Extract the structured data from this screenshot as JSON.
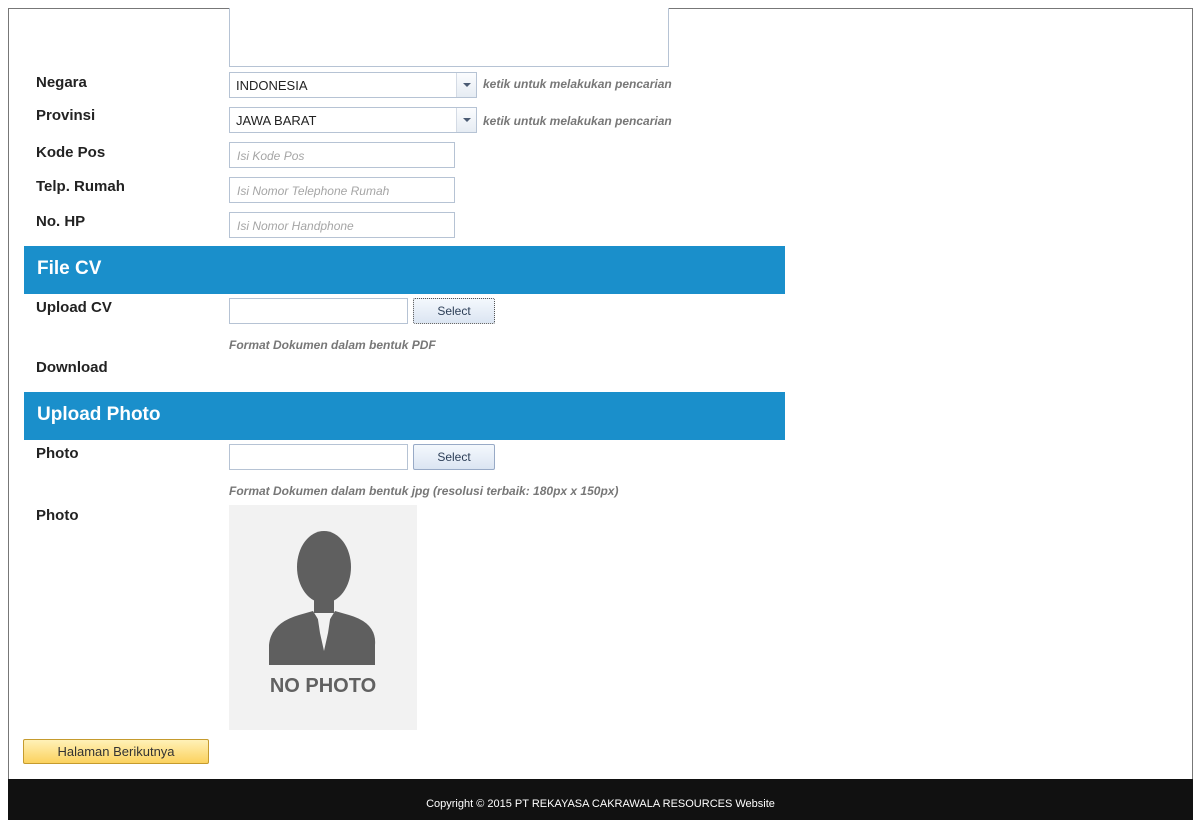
{
  "form": {
    "negara": {
      "label": "Negara",
      "value": "INDONESIA",
      "hint": "ketik untuk melakukan pencarian"
    },
    "provinsi": {
      "label": "Provinsi",
      "value": "JAWA BARAT",
      "hint": "ketik untuk melakukan pencarian"
    },
    "kode_pos": {
      "label": "Kode Pos",
      "placeholder": "Isi Kode Pos"
    },
    "telp_rumah": {
      "label": "Telp. Rumah",
      "placeholder": "Isi Nomor Telephone Rumah"
    },
    "no_hp": {
      "label": "No. HP",
      "placeholder": "Isi Nomor Handphone"
    }
  },
  "file_cv": {
    "section_title": "File CV",
    "upload_label": "Upload CV",
    "select_label": "Select",
    "format_note": "Format Dokumen dalam bentuk PDF",
    "download_label": "Download"
  },
  "upload_photo": {
    "section_title": "Upload Photo",
    "photo_label": "Photo",
    "select_label": "Select",
    "format_note": "Format Dokumen dalam bentuk jpg (resolusi terbaik: 180px x 150px)",
    "preview_label": "Photo",
    "no_photo_text": "NO PHOTO"
  },
  "next_button_label": "Halaman Berikutnya",
  "footer_text": "Copyright © 2015 PT REKAYASA CAKRAWALA RESOURCES Website",
  "colors": {
    "section_bg": "#1a8fcb",
    "footer_bg": "#111111",
    "next_btn": "#fbd25e"
  }
}
